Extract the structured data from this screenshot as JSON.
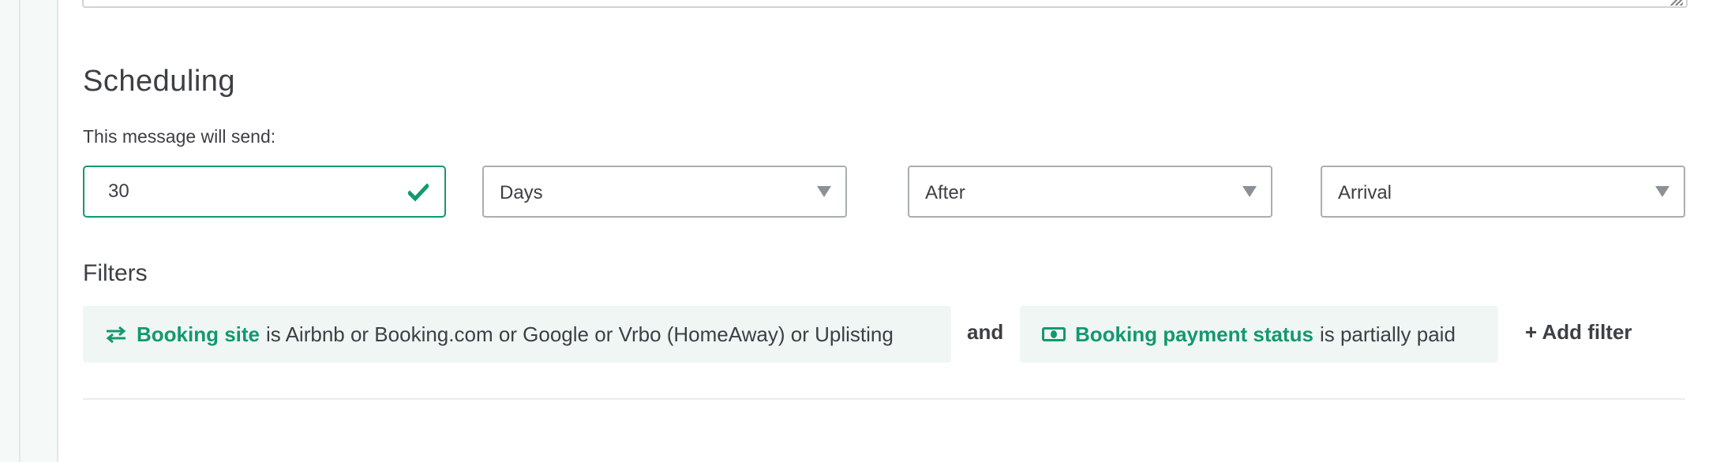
{
  "scheduling": {
    "title": "Scheduling",
    "send_label": "This message will send:",
    "amount_value": "30",
    "unit_select": "Days",
    "direction_select": "After",
    "event_select": "Arrival"
  },
  "filters": {
    "title": "Filters",
    "items": [
      {
        "icon": "swap-arrows-icon",
        "key": "Booking site",
        "condition": "is Airbnb or Booking.com or Google or Vrbo (HomeAway) or Uplisting"
      },
      {
        "icon": "banknote-icon",
        "key": "Booking payment status",
        "condition": "is partially paid"
      }
    ],
    "joiner": "and",
    "add_filter_label": "+ Add filter"
  },
  "colors": {
    "accent": "#12996f",
    "chip_bg": "#f0f6f4",
    "text": "#3c3f44",
    "border": "#a9aeb1"
  }
}
